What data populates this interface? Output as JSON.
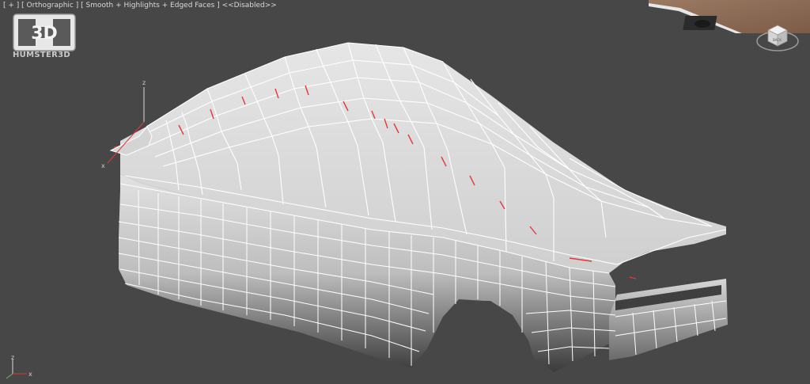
{
  "viewport": {
    "label_parts": [
      "[ + ]",
      "[ Orthographic ]",
      "[ Smooth + Highlights + Edged Faces ]",
      "<<Disabled>>"
    ]
  },
  "logo": {
    "badge_text": "3D",
    "brand_text": "HUMSTER3D"
  },
  "gizmo": {
    "z": "z",
    "x": "x"
  },
  "corner_axis": {
    "z": "z",
    "x": "x"
  },
  "viewcube": {
    "face_label": "BACK"
  },
  "colors": {
    "viewport_bg": "#474747",
    "mesh_fill": "#d9d9d9",
    "wire": "#ffffff",
    "seam": "#e23a3a"
  }
}
